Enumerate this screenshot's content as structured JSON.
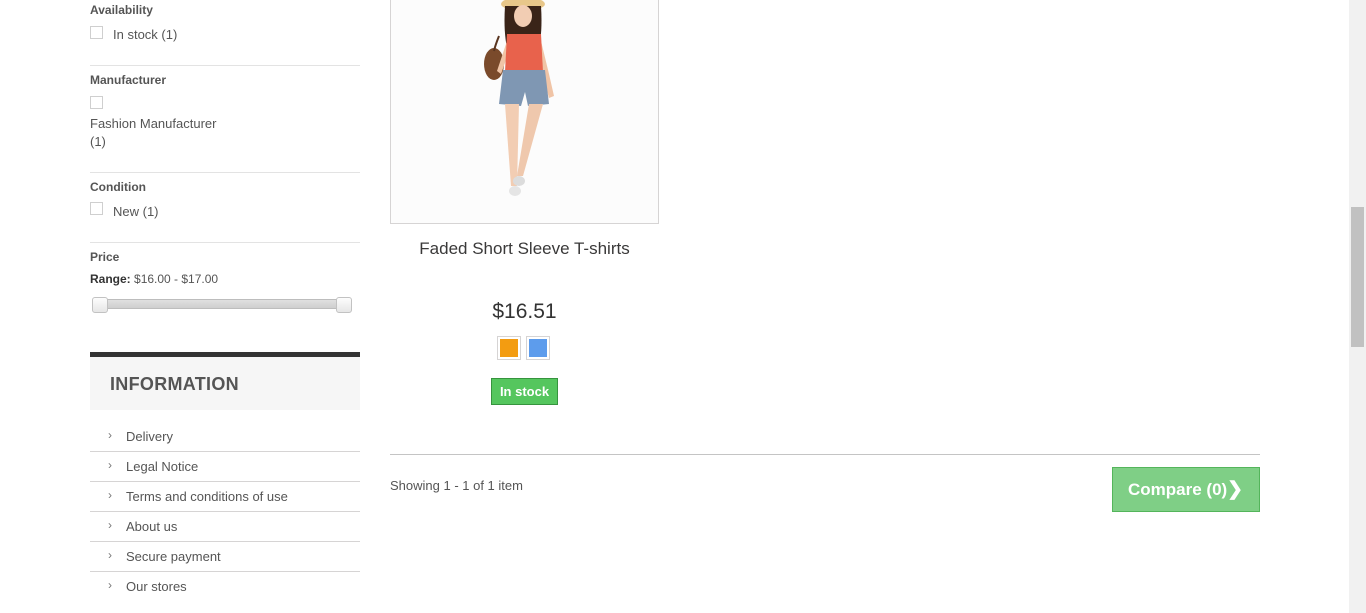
{
  "filters": {
    "availability": {
      "title": "Availability",
      "option": "In stock (1)"
    },
    "manufacturer": {
      "title": "Manufacturer",
      "option_line1": "Fashion Manufacturer",
      "option_line2": "(1)"
    },
    "condition": {
      "title": "Condition",
      "option": "New (1)"
    },
    "price": {
      "title": "Price",
      "range_label": "Range:",
      "range_value": "$16.00 - $17.00",
      "min": 16.0,
      "max": 17.0
    }
  },
  "information": {
    "title": "INFORMATION",
    "items": [
      {
        "label": "Delivery"
      },
      {
        "label": "Legal Notice"
      },
      {
        "label": "Terms and conditions of use"
      },
      {
        "label": "About us"
      },
      {
        "label": "Secure payment"
      },
      {
        "label": "Our stores"
      }
    ]
  },
  "product": {
    "name": "Faded Short Sleeve T-shirts",
    "price": "$16.51",
    "colors": [
      "#f39c11",
      "#5d9cec"
    ],
    "availability": "In stock"
  },
  "listing": {
    "showing": "Showing 1 - 1 of 1 item",
    "compare_label": "Compare (0)",
    "compare_icon": "chevron-right-icon"
  }
}
